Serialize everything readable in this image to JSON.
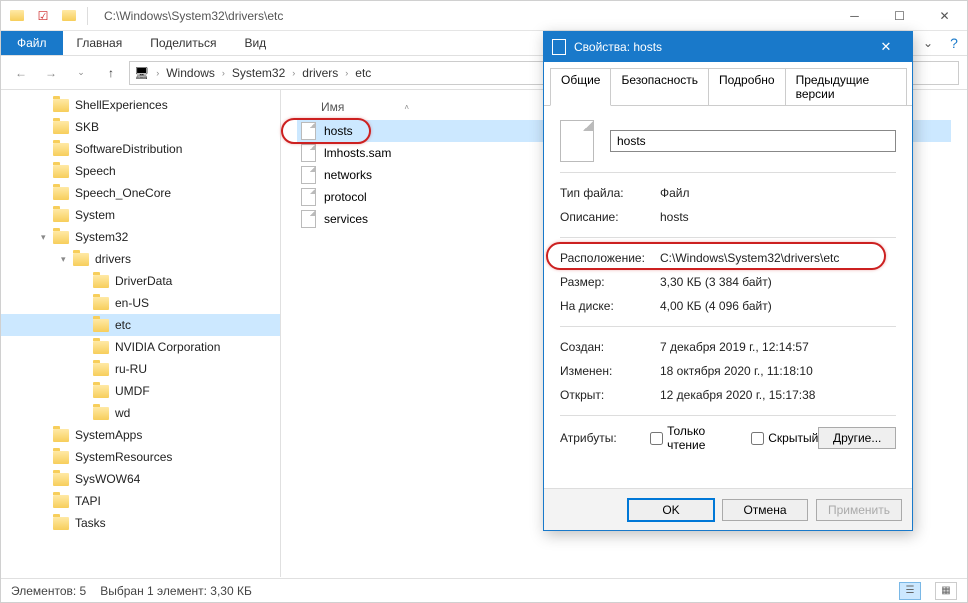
{
  "title_path": "C:\\Windows\\System32\\drivers\\etc",
  "ribbon": {
    "file": "Файл",
    "home": "Главная",
    "share": "Поделиться",
    "view": "Вид"
  },
  "breadcrumbs": [
    "Windows",
    "System32",
    "drivers",
    "etc"
  ],
  "columns": {
    "name": "Имя"
  },
  "tree": [
    {
      "label": "ShellExperiences",
      "depth": 1,
      "caret": ""
    },
    {
      "label": "SKB",
      "depth": 1,
      "caret": ""
    },
    {
      "label": "SoftwareDistribution",
      "depth": 1,
      "caret": ""
    },
    {
      "label": "Speech",
      "depth": 1,
      "caret": ""
    },
    {
      "label": "Speech_OneCore",
      "depth": 1,
      "caret": ""
    },
    {
      "label": "System",
      "depth": 1,
      "caret": ""
    },
    {
      "label": "System32",
      "depth": 1,
      "caret": "▾"
    },
    {
      "label": "drivers",
      "depth": 2,
      "caret": "▾"
    },
    {
      "label": "DriverData",
      "depth": 3,
      "caret": ""
    },
    {
      "label": "en-US",
      "depth": 3,
      "caret": ""
    },
    {
      "label": "etc",
      "depth": 3,
      "caret": "",
      "selected": true
    },
    {
      "label": "NVIDIA Corporation",
      "depth": 3,
      "caret": ""
    },
    {
      "label": "ru-RU",
      "depth": 3,
      "caret": ""
    },
    {
      "label": "UMDF",
      "depth": 3,
      "caret": ""
    },
    {
      "label": "wd",
      "depth": 3,
      "caret": ""
    },
    {
      "label": "SystemApps",
      "depth": 1,
      "caret": ""
    },
    {
      "label": "SystemResources",
      "depth": 1,
      "caret": ""
    },
    {
      "label": "SysWOW64",
      "depth": 1,
      "caret": ""
    },
    {
      "label": "TAPI",
      "depth": 1,
      "caret": ""
    },
    {
      "label": "Tasks",
      "depth": 1,
      "caret": ""
    }
  ],
  "files": [
    {
      "name": "hosts",
      "selected": true
    },
    {
      "name": "lmhosts.sam"
    },
    {
      "name": "networks"
    },
    {
      "name": "protocol"
    },
    {
      "name": "services"
    }
  ],
  "status": {
    "count": "Элементов: 5",
    "selected": "Выбран 1 элемент: 3,30 КБ"
  },
  "dialog": {
    "title": "Свойства: hosts",
    "tabs": {
      "general": "Общие",
      "security": "Безопасность",
      "details": "Подробно",
      "prev": "Предыдущие версии"
    },
    "filename": "hosts",
    "type_k": "Тип файла:",
    "type_v": "Файл",
    "desc_k": "Описание:",
    "desc_v": "hosts",
    "loc_k": "Расположение:",
    "loc_v": "C:\\Windows\\System32\\drivers\\etc",
    "size_k": "Размер:",
    "size_v": "3,30 КБ (3 384 байт)",
    "disk_k": "На диске:",
    "disk_v": "4,00 КБ (4 096 байт)",
    "created_k": "Создан:",
    "created_v": "7 декабря 2019 г., 12:14:57",
    "modified_k": "Изменен:",
    "modified_v": "18 октября 2020 г., 11:18:10",
    "opened_k": "Открыт:",
    "opened_v": "12 декабря 2020 г., 15:17:38",
    "attr_k": "Атрибуты:",
    "readonly": "Только чтение",
    "hidden": "Скрытый",
    "other": "Другие...",
    "ok": "OK",
    "cancel": "Отмена",
    "apply": "Применить"
  }
}
